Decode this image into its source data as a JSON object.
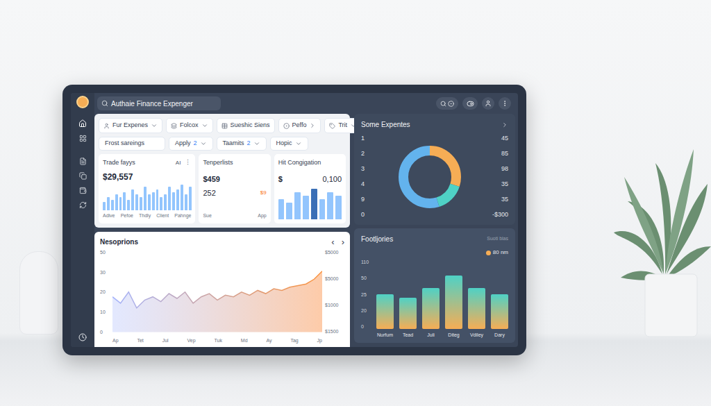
{
  "search": {
    "text": "Authaie Finance Expenger"
  },
  "filters_row1": [
    {
      "label": "Fur Expenes",
      "chevron": "down"
    },
    {
      "label": "Folcox",
      "chevron": "down"
    },
    {
      "label": "Sueshic Siens",
      "chevron": "none"
    },
    {
      "label": "Peffo",
      "chevron": "right"
    },
    {
      "label": "Trit",
      "chevron": "down"
    }
  ],
  "filters_row2": [
    {
      "label": "Frost sareings",
      "count": "",
      "chevron": "none"
    },
    {
      "label": "Apply",
      "count": "2",
      "chevron": "down"
    },
    {
      "label": "Taamits",
      "count": "2",
      "chevron": "down"
    },
    {
      "label": "Hopic",
      "count": "",
      "chevron": "down"
    }
  ],
  "card_trade": {
    "title": "Trade fayys",
    "badge": "AI",
    "menu": "⋮",
    "value": "$29,557",
    "bars": [
      3,
      5,
      4,
      6,
      5,
      7,
      4,
      8,
      6,
      5,
      9,
      6,
      7,
      8,
      5,
      6,
      9,
      7,
      8,
      10,
      6,
      9
    ],
    "labels": [
      "Adive",
      "Pefoe",
      "Thdly",
      "Client",
      "Pahnge"
    ]
  },
  "card_tenper": {
    "title": "Tenperlists",
    "value": "$459",
    "row": {
      "left": "252",
      "right": "$9"
    },
    "labels": [
      "Sue",
      "App"
    ]
  },
  "card_hit": {
    "title": "Hit Congigation",
    "currency": "$",
    "value": "0,100",
    "bars": [
      6,
      5,
      8,
      7,
      9,
      6,
      8,
      7
    ]
  },
  "line_chart": {
    "title": "Nesoprions",
    "prev": "‹",
    "next": "›",
    "y_ticks": [
      "50",
      "30",
      "20",
      "10",
      "0"
    ],
    "y_ticks_right": [
      "$5000",
      "$5000",
      "$1000",
      "$1500"
    ],
    "x_labels": [
      "Ap",
      "Tet",
      "Jul",
      "Vep",
      "Tuk",
      "Md",
      "Ay",
      "Tag",
      "Jp"
    ],
    "max": 50,
    "values": [
      22,
      18,
      25,
      15,
      20,
      22,
      19,
      24,
      21,
      25,
      18,
      22,
      24,
      20,
      23,
      22,
      25,
      23,
      26,
      24,
      27,
      26,
      28,
      29,
      30,
      33,
      38
    ]
  },
  "expenses": {
    "title": "Some Expentes",
    "left": [
      "1",
      "2",
      "3",
      "4",
      "9",
      "0"
    ],
    "right": [
      "45",
      "85",
      "98",
      "35",
      "35",
      "-$300"
    ],
    "segments": [
      {
        "value": 30,
        "color": "#f6ad55"
      },
      {
        "value": 15,
        "color": "#4fd1c5"
      },
      {
        "value": 55,
        "color": "#63b3ed"
      }
    ]
  },
  "bar_chart": {
    "title": "Footljories",
    "subtitle": "Suoti blas",
    "legend": "80 nm",
    "y_ticks": [
      "110",
      "50",
      "25",
      "20",
      "0"
    ],
    "max": 110,
    "bars": [
      {
        "label": "Nurfum",
        "value": 55
      },
      {
        "label": "Tead",
        "value": 50
      },
      {
        "label": "Juli",
        "value": 65
      },
      {
        "label": "Diteg",
        "value": 85
      },
      {
        "label": "Vdiley",
        "value": 65
      },
      {
        "label": "Dary",
        "value": 55
      }
    ]
  }
}
